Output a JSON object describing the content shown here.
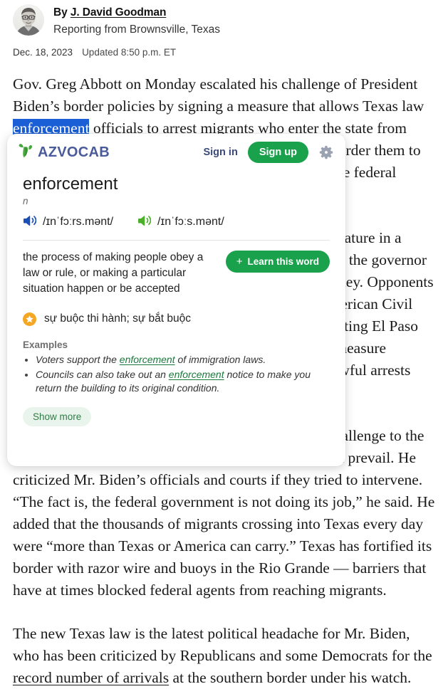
{
  "article": {
    "byline": {
      "by_prefix": "By ",
      "author": "J. David Goodman",
      "reporting_from": "Reporting from Brownsville, Texas",
      "avatar_alt": "author-portrait"
    },
    "dateline": {
      "date": "Dec. 18, 2023",
      "updated": "Updated 8:50 p.m. ET"
    },
    "paragraphs": {
      "p1_before": "Gov. Greg Abbott on Monday escalated his challenge of President Biden’s border policies by signing a measure that allows Texas law ",
      "p1_selected": "enforcement",
      "p1_after": " officials to arrest migrants who enter the state from Mexico illegally and gives local judges the ability to order them to leave the country, a power that has long rested with the federal government.",
      "p2": "The legislation, which was passed by the Texas Legislature in a special session, was one of several border-related bills the governor signed into law in Brownsville, in the Rio Grande Valley. Opponents of the measure last month sued the state, with the American Civil Liberties Union and immigrant-rights groups representing El Paso County and two advocacy organizations arguing the measure violated the U.S. Constitution and would lead to unlawful arrests and racial profiling.",
      "p3": "Mr. Abbott acknowledged the likelihood of a court challenge to the legislation, expressing confidence that the state would prevail. He criticized Mr. Biden’s officials and courts if they tried to intervene. “The fact is, the federal government is not doing its job,” he said. He added that the thousands of migrants crossing into Texas every day were “more than Texas or America can carry.” Texas has fortified its border with razor wire and buoys in the Rio Grande — barriers that have at times blocked federal agents from reaching migrants.",
      "p4_before": "The new Texas law is the latest political headache for Mr. Biden, who has been criticized by Republicans and some Democrats for the ",
      "p4_link": "record number of arrivals",
      "p4_after": " at the southern border under his watch."
    }
  },
  "popup": {
    "brand": {
      "logo_text": "AZVOCAB",
      "logo_icon": "leaf-sprout-icon"
    },
    "header": {
      "sign_in_label": "Sign in",
      "sign_up_label": "Sign up",
      "settings_icon": "gear-icon"
    },
    "word": {
      "headword": "enforcement",
      "part_of_speech": "n"
    },
    "pronunciations": [
      {
        "ipa": "/ɪnˈfɔːrs.mənt/",
        "accent_color": "#1a5fd6",
        "icon": "speaker-icon"
      },
      {
        "ipa": "/ɪnˈfɔːs.mənt/",
        "accent_color": "#4caf2b",
        "icon": "speaker-icon"
      }
    ],
    "definition": "the process of making people obey a law or rule, or making a particular situation happen or be accepted",
    "learn_button": {
      "label": "Learn this word",
      "plus": "+"
    },
    "translation": {
      "text": "sự buộc thi hành; sự bắt buộc",
      "badge_icon": "star-icon"
    },
    "examples": {
      "title": "Examples",
      "items": [
        {
          "before": "Voters support the ",
          "highlight": "enforcement",
          "after": " of immigration laws."
        },
        {
          "before": "Councils can also take out an ",
          "highlight": "enforcement",
          "after": " notice to make you return the building to its original condition."
        }
      ]
    },
    "show_more_label": "Show more"
  },
  "colors": {
    "brand_green": "#1aa14b",
    "brand_blue": "#4a5b9b",
    "selection_blue": "#1a5fd6",
    "star_orange": "#f5a623",
    "example_link_green": "#1a7a3c"
  }
}
